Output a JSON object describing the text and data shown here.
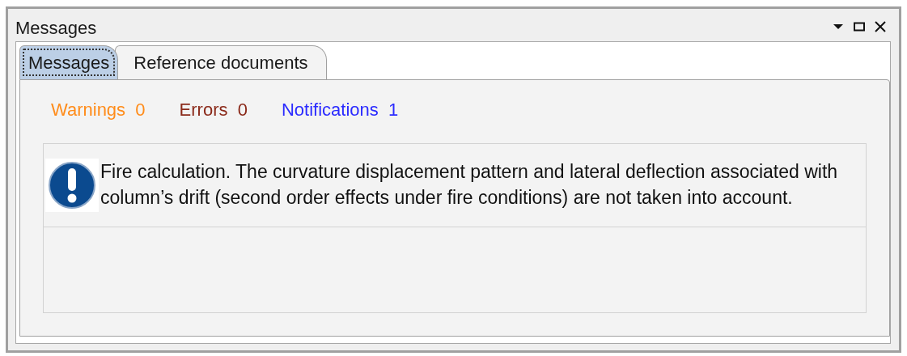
{
  "window": {
    "title": "Messages"
  },
  "tabs": [
    {
      "label": "Messages",
      "selected": true
    },
    {
      "label": "Reference documents",
      "selected": false
    }
  ],
  "counters": [
    {
      "label": "Warnings",
      "count": "0",
      "color": "#ff8c1a"
    },
    {
      "label": "Errors",
      "count": "0",
      "color": "#8b2a1a"
    },
    {
      "label": "Notifications",
      "count": "1",
      "color": "#2b2bff"
    }
  ],
  "messages": [
    {
      "kind": "notification",
      "text": "Fire calculation. The curvature displacement pattern and lateral deflection associated with column’s drift (second order effects under fire conditions) are not taken into account."
    }
  ]
}
